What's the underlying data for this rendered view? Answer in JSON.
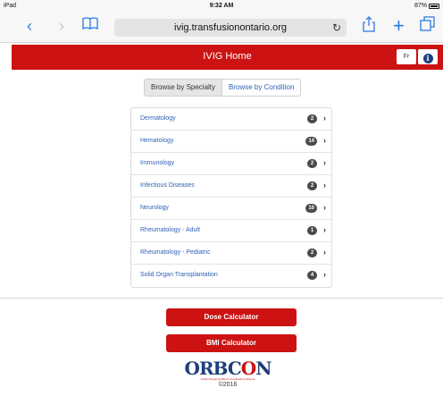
{
  "status_bar": {
    "device": "iPad",
    "time": "9:32 AM",
    "battery": "87%"
  },
  "browser": {
    "url": "ivig.transfusionontario.org",
    "icons": [
      "back-icon",
      "forward-icon",
      "bookmarks-icon",
      "reload-icon",
      "share-icon",
      "new-tab-icon",
      "tabs-icon"
    ]
  },
  "header": {
    "title": "IVIG Home",
    "lang_label": "Fr",
    "info_label": "i",
    "color": "#cc1212"
  },
  "tabs": [
    {
      "label": "Browse by Specialty",
      "active": true
    },
    {
      "label": "Browse by Condition",
      "active": false
    }
  ],
  "specialties": [
    {
      "label": "Dermatology",
      "count": "2"
    },
    {
      "label": "Hematology",
      "count": "14"
    },
    {
      "label": "Immunology",
      "count": "2"
    },
    {
      "label": "Infectious Diseases",
      "count": "2"
    },
    {
      "label": "Neurology",
      "count": "10"
    },
    {
      "label": "Rheumatology - Adult",
      "count": "1"
    },
    {
      "label": "Rheumatology - Pediatric",
      "count": "2"
    },
    {
      "label": "Solid Organ Transplantation",
      "count": "4"
    }
  ],
  "buttons": {
    "dose_calculator": "Dose Calculator",
    "bmi_calculator": "BMI Calculator"
  },
  "footer": {
    "logo_prefix": "ORBC",
    "logo_o": "O",
    "logo_suffix": "N",
    "logo_tagline": "Ontario Regional Blood Coordinating Network",
    "copyright": "©2016"
  }
}
